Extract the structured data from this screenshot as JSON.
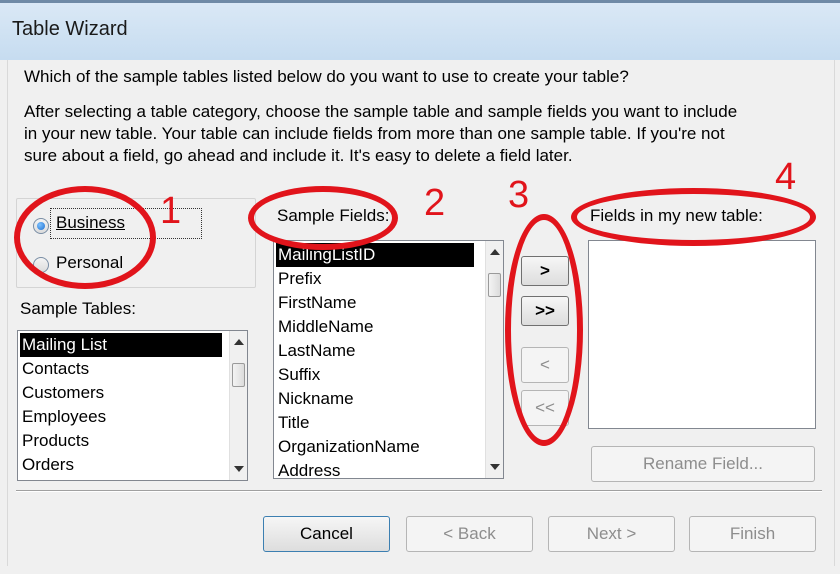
{
  "window": {
    "title": "Table Wizard"
  },
  "question": "Which of the sample tables listed below do you want to use to create your table?",
  "instructions": [
    "After selecting a table category, choose the sample table and sample fields you want to include",
    "in your new table. Your table can include fields from more than one sample table. If you're not",
    "sure about a field, go ahead and include it. It's easy to delete a field later."
  ],
  "category": {
    "options": [
      {
        "label": "Business",
        "selected": true
      },
      {
        "label": "Personal",
        "selected": false
      }
    ]
  },
  "sample_tables": {
    "label": "Sample Tables:",
    "items": [
      "Mailing List",
      "Contacts",
      "Customers",
      "Employees",
      "Products",
      "Orders"
    ],
    "selected": "Mailing List"
  },
  "sample_fields": {
    "label": "Sample Fields:",
    "items": [
      "MailingListID",
      "Prefix",
      "FirstName",
      "MiddleName",
      "LastName",
      "Suffix",
      "Nickname",
      "Title",
      "OrganizationName",
      "Address"
    ],
    "selected": "MailingListID"
  },
  "new_table": {
    "label": "Fields in my new table:",
    "items": []
  },
  "move_buttons": {
    "add_one": ">",
    "add_all": ">>",
    "remove_one": "<",
    "remove_all": "<<"
  },
  "rename_button": "Rename Field...",
  "footer": {
    "cancel": "Cancel",
    "back": "< Back",
    "next": "Next >",
    "finish": "Finish"
  },
  "annotations": [
    "1",
    "2",
    "3",
    "4"
  ],
  "colors": {
    "annotation": "#e1141b",
    "selection": "#000000",
    "titlebar": "#c6dcf0"
  }
}
